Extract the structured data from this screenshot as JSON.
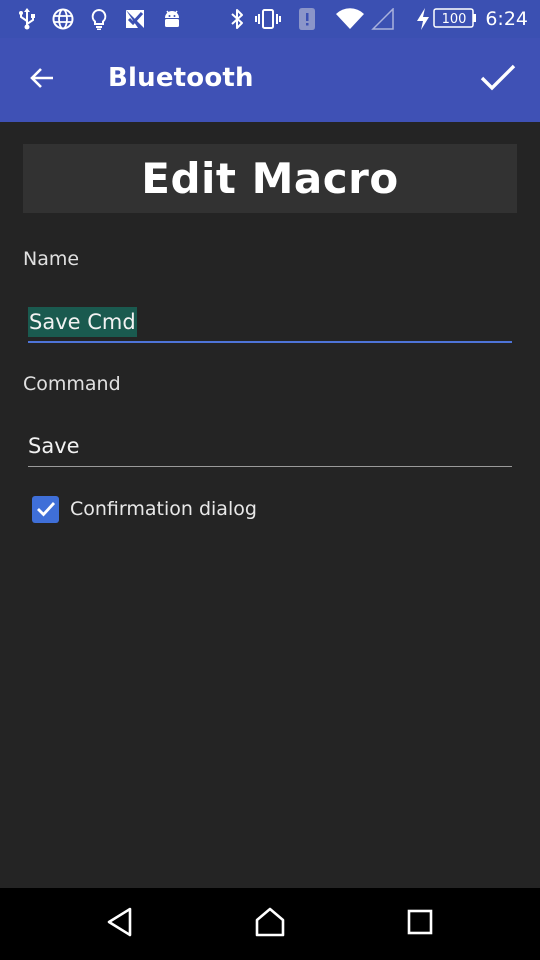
{
  "status_bar": {
    "time": "6:24",
    "battery_level": "100",
    "icons": [
      "usb-icon",
      "globe-icon",
      "lightbulb-icon",
      "check-flag-icon",
      "android-icon",
      "bluetooth-icon",
      "vibrate-icon",
      "sim-alert-icon",
      "wifi-icon",
      "cell-signal-icon",
      "charging-icon",
      "battery-icon"
    ]
  },
  "app_bar": {
    "title": "Bluetooth",
    "back_icon": "arrow-left-icon",
    "confirm_icon": "check-icon"
  },
  "content": {
    "header": "Edit Macro",
    "name_label": "Name",
    "name_value": "Save Cmd",
    "command_label": "Command",
    "command_value": "Save",
    "confirmation_label": "Confirmation dialog",
    "confirmation_checked": true
  },
  "colors": {
    "app_bar": "#3f51b5",
    "status_bar": "#3b50b2",
    "background": "#242424",
    "accent": "#4e74d8",
    "selection": "#1a5a4f"
  },
  "nav_bar": {
    "icons": [
      "back-triangle-icon",
      "home-icon",
      "recents-icon"
    ]
  }
}
